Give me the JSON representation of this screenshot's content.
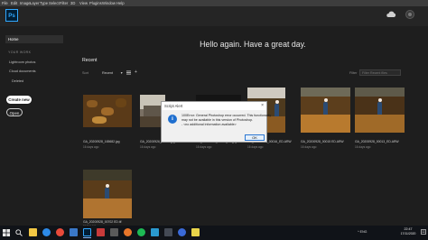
{
  "menubar": {
    "items": [
      "File",
      "Edit",
      "Image",
      "Layer",
      "Type",
      "Select",
      "Filter",
      "3D",
      "View",
      "Plugins",
      "Window",
      "Help"
    ]
  },
  "app": {
    "logo_text": "Ps"
  },
  "sidebar": {
    "home_label": "Home",
    "section_label": "YOUR WORK",
    "links": [
      "Lightroom photos",
      "Cloud documents",
      "Deleted"
    ],
    "create_new": "Create new",
    "open": "Open"
  },
  "main": {
    "greeting": "Hello again. Have a great day.",
    "recent_title": "Recent",
    "sort_label": "Sort",
    "sort_value": "Recent",
    "filter_label": "Filter",
    "filter_placeholder": "Filter Recent files",
    "files": [
      {
        "name": "GA_20200928_165682.jpg",
        "date": "16 days ago"
      },
      {
        "name": "GA_20200926_00008.jpg",
        "date": "16 days ago"
      },
      {
        "name": "GA_20200928_00056_FD.jpg",
        "date": "16 days ago"
      },
      {
        "name": "GA_20200928_00016_ED.ARW",
        "date": "16 days ago"
      },
      {
        "name": "GA_20200928_00015 ED.ARW",
        "date": "16 days ago"
      },
      {
        "name": "GA_20200928_00013_ED.ARW",
        "date": "16 days ago"
      },
      {
        "name": "GA_20200928_00702 ED.tif",
        "date": "16 days ago"
      }
    ]
  },
  "dialog": {
    "title": "Script Alert",
    "line1": "100Error: General Photoshop error occurred. This functionality",
    "line2": "may not be available in this version of Photoshop.",
    "line3": "- <no additional information available>",
    "ok": "OK"
  },
  "taskbar": {
    "tray_text": "^  ENG",
    "time": "22:47",
    "date": "17/11/2020",
    "apps": [
      "explorer",
      "edge",
      "chrome",
      "store",
      "photoshop",
      "mail",
      "settings",
      "firefox",
      "music",
      "files",
      "terminal",
      "browser",
      "stickies"
    ]
  },
  "colors": {
    "accent": "#31a8ff",
    "dialog_button_border": "#2a76d2"
  }
}
